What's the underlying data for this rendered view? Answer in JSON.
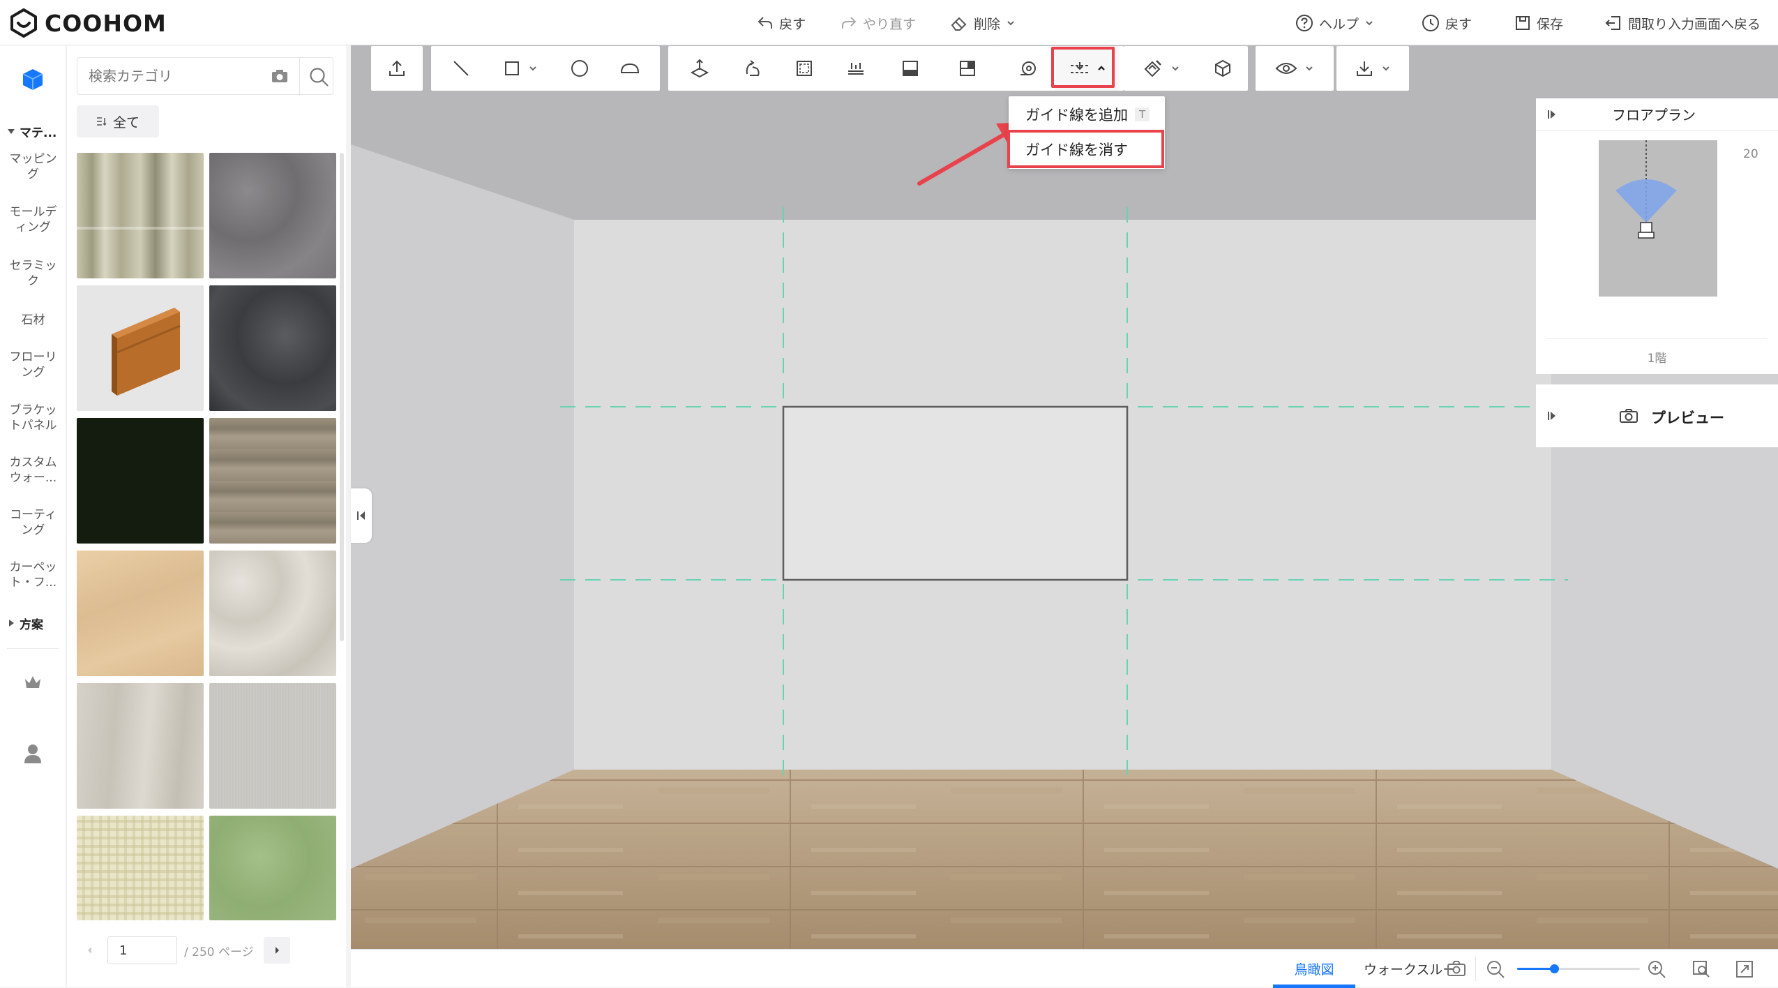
{
  "app": {
    "brand": "COOHOM"
  },
  "topbar": {
    "undo": "戻す",
    "redo": "やり直す",
    "delete": "削除",
    "help": "ヘルプ",
    "history": "戻す",
    "save": "保存",
    "back_to_floorplan": "間取り入力画面へ戻る"
  },
  "rail": {
    "material_section": "マテ...",
    "items": [
      "マッピング",
      "モールディング",
      "セラミック",
      "石材",
      "フローリング",
      "ブラケットパネル",
      "カスタムウォー...",
      "コーティング",
      "カーペット・フ..."
    ],
    "plan_section": "方案"
  },
  "materials": {
    "search_placeholder": "検索カテゴリ",
    "all_label": "全て",
    "tiles": [
      {
        "name": "birch-wood",
        "color": "#b9b59a"
      },
      {
        "name": "gray-fabric",
        "color": "#7d7b7e"
      },
      {
        "name": "wood-molding",
        "color": "#e6e6e6"
      },
      {
        "name": "dark-stone",
        "color": "#3e4044"
      },
      {
        "name": "black-solid",
        "color": "#141c10"
      },
      {
        "name": "gray-oak",
        "color": "#958a79"
      },
      {
        "name": "light-maple",
        "color": "#e2c49b"
      },
      {
        "name": "marble-tile",
        "color": "#d8d4cc"
      },
      {
        "name": "pale-wood",
        "color": "#d3cfc6"
      },
      {
        "name": "gray-wallpaper",
        "color": "#c9c7c2"
      },
      {
        "name": "plaid-fabric",
        "color": "#e9e5c9"
      },
      {
        "name": "green-plaster",
        "color": "#97b57c"
      }
    ],
    "pager": {
      "current": "1",
      "total": "/ 250 ページ"
    }
  },
  "guide_menu": {
    "add": "ガイド線を追加",
    "add_shortcut": "T",
    "hide": "ガイド線を消す"
  },
  "floorplan": {
    "title": "フロアプラン",
    "zoom": "20",
    "floor": "1階"
  },
  "preview": {
    "label": "プレビュー"
  },
  "bottom": {
    "tab_aerial": "鳥瞰図",
    "tab_walk": "ウォークスルー",
    "zoom_level": 0.3
  },
  "colors": {
    "accent": "#1677ff",
    "highlight": "#e8424c",
    "guide_line": "#67d3b1"
  }
}
